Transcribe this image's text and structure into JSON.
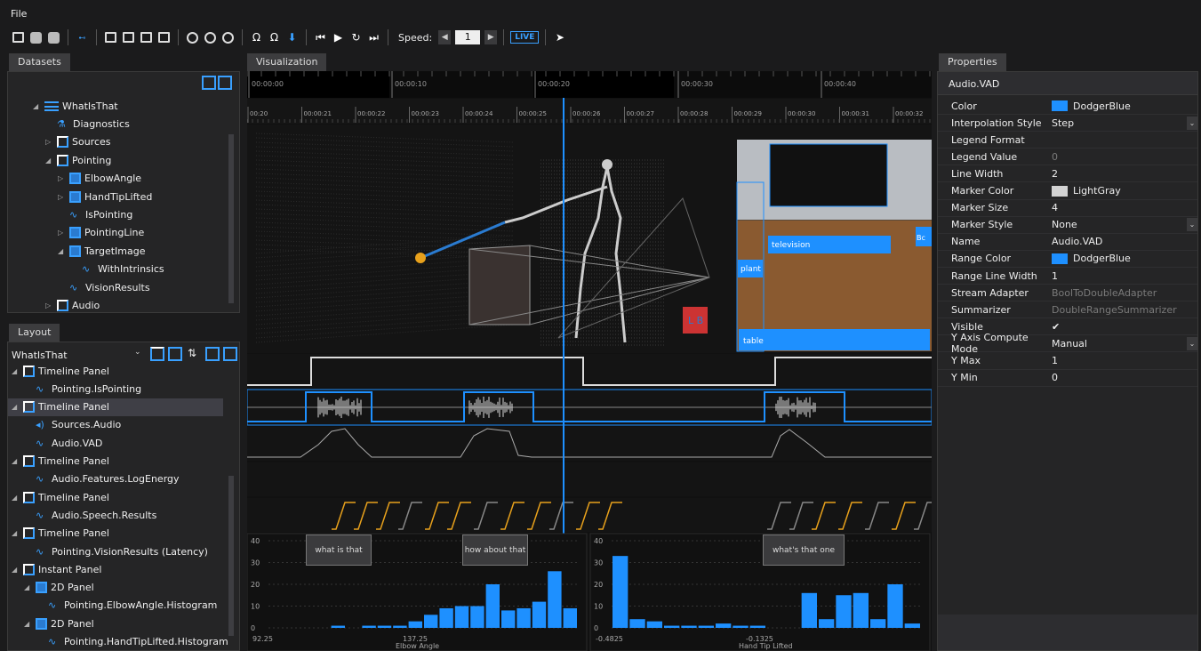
{
  "menu": {
    "file": "File"
  },
  "toolbar": {
    "speed_label": "Speed:",
    "speed_value": "1",
    "live": "LIVE"
  },
  "tabs": {
    "datasets": "Datasets",
    "visualization": "Visualization",
    "properties": "Properties",
    "layout": "Layout"
  },
  "datasets": {
    "items": [
      {
        "label": "WhatIsThat",
        "indent": 0,
        "arrow": "◢",
        "icon": "dataset"
      },
      {
        "label": "Diagnostics",
        "indent": 1,
        "arrow": "",
        "icon": "diag"
      },
      {
        "label": "Sources",
        "indent": 1,
        "arrow": "▷",
        "icon": "box"
      },
      {
        "label": "Pointing",
        "indent": 1,
        "arrow": "◢",
        "icon": "box"
      },
      {
        "label": "ElbowAngle",
        "indent": 2,
        "arrow": "▷",
        "icon": "bluebox"
      },
      {
        "label": "HandTipLifted",
        "indent": 2,
        "arrow": "▷",
        "icon": "bluebox"
      },
      {
        "label": "IsPointing",
        "indent": 2,
        "arrow": "",
        "icon": "wave"
      },
      {
        "label": "PointingLine",
        "indent": 2,
        "arrow": "▷",
        "icon": "bluebox"
      },
      {
        "label": "TargetImage",
        "indent": 2,
        "arrow": "◢",
        "icon": "bluebox"
      },
      {
        "label": "WithIntrinsics",
        "indent": 3,
        "arrow": "",
        "icon": "wave"
      },
      {
        "label": "VisionResults",
        "indent": 2,
        "arrow": "",
        "icon": "wave"
      },
      {
        "label": "Audio",
        "indent": 1,
        "arrow": "▷",
        "icon": "box"
      }
    ]
  },
  "layout": {
    "selected": "WhatIsThat",
    "items": [
      {
        "label": "Timeline Panel",
        "indent": 0,
        "arrow": "◢",
        "icon": "box"
      },
      {
        "label": "Pointing.IsPointing",
        "indent": 1,
        "arrow": "",
        "icon": "wave"
      },
      {
        "label": "Timeline Panel",
        "indent": 0,
        "arrow": "◢",
        "icon": "box",
        "selected": true
      },
      {
        "label": "Sources.Audio",
        "indent": 1,
        "arrow": "",
        "icon": "audio"
      },
      {
        "label": "Audio.VAD",
        "indent": 1,
        "arrow": "",
        "icon": "wave"
      },
      {
        "label": "Timeline Panel",
        "indent": 0,
        "arrow": "◢",
        "icon": "box"
      },
      {
        "label": "Audio.Features.LogEnergy",
        "indent": 1,
        "arrow": "",
        "icon": "wave"
      },
      {
        "label": "Timeline Panel",
        "indent": 0,
        "arrow": "◢",
        "icon": "box"
      },
      {
        "label": "Audio.Speech.Results",
        "indent": 1,
        "arrow": "",
        "icon": "wave"
      },
      {
        "label": "Timeline Panel",
        "indent": 0,
        "arrow": "◢",
        "icon": "box"
      },
      {
        "label": "Pointing.VisionResults (Latency)",
        "indent": 1,
        "arrow": "",
        "icon": "wave"
      },
      {
        "label": "Instant Panel",
        "indent": 0,
        "arrow": "◢",
        "icon": "box"
      },
      {
        "label": "2D Panel",
        "indent": 1,
        "arrow": "◢",
        "icon": "bluebox"
      },
      {
        "label": "Pointing.ElbowAngle.Histogram",
        "indent": 2,
        "arrow": "",
        "icon": "wave"
      },
      {
        "label": "2D Panel",
        "indent": 1,
        "arrow": "◢",
        "icon": "bluebox"
      },
      {
        "label": "Pointing.HandTipLifted.Histogram",
        "indent": 2,
        "arrow": "",
        "icon": "wave"
      }
    ]
  },
  "timeline": {
    "overview_ticks": [
      "00:00:00",
      "00:00:10",
      "00:00:20",
      "00:00:30",
      "00:00:40"
    ],
    "detail_ticks": [
      "00:20",
      "00:00:21",
      "00:00:22",
      "00:00:23",
      "00:00:24",
      "00:00:25",
      "00:00:26",
      "00:00:27",
      "00:00:28",
      "00:00:29",
      "00:00:30",
      "00:00:31",
      "00:00:32"
    ]
  },
  "scene": {
    "labels": {
      "television": "television",
      "plant": "plant",
      "table": "table",
      "bc": "Bc"
    }
  },
  "speech": [
    "what is that",
    "how about that",
    "what's that one"
  ],
  "chart_data": [
    {
      "type": "bar",
      "xlabel": "Elbow Angle",
      "x_ticks": [
        "92.25",
        "137.25"
      ],
      "y_ticks": [
        "0",
        "10",
        "20",
        "30",
        "40"
      ],
      "ylim": [
        0,
        40
      ],
      "grid": true,
      "values": [
        0,
        0,
        0,
        0,
        1,
        0,
        1,
        1,
        1,
        3,
        6,
        9,
        10,
        10,
        20,
        8,
        9,
        12,
        26,
        9
      ]
    },
    {
      "type": "bar",
      "xlabel": "Hand Tip Lifted",
      "x_ticks": [
        "-0.4825",
        "-0.1325"
      ],
      "y_ticks": [
        "0",
        "10",
        "20",
        "30",
        "40"
      ],
      "ylim": [
        0,
        40
      ],
      "grid": true,
      "values": [
        33,
        4,
        3,
        1,
        1,
        1,
        2,
        1,
        1,
        0,
        0,
        16,
        4,
        15,
        16,
        4,
        20,
        2
      ]
    }
  ],
  "properties": {
    "title": "Audio.VAD",
    "rows": [
      {
        "name": "Color",
        "value": "DodgerBlue",
        "swatch": "#1e90ff"
      },
      {
        "name": "Interpolation Style",
        "value": "Step",
        "dropdown": true
      },
      {
        "name": "Legend Format",
        "value": ""
      },
      {
        "name": "Legend Value",
        "value": "0",
        "dim": true
      },
      {
        "name": "Line Width",
        "value": "2"
      },
      {
        "name": "Marker Color",
        "value": "LightGray",
        "swatch": "#d3d3d3"
      },
      {
        "name": "Marker Size",
        "value": "4"
      },
      {
        "name": "Marker Style",
        "value": "None",
        "dropdown": true
      },
      {
        "name": "Name",
        "value": "Audio.VAD"
      },
      {
        "name": "Range Color",
        "value": "DodgerBlue",
        "swatch": "#1e90ff"
      },
      {
        "name": "Range Line Width",
        "value": "1"
      },
      {
        "name": "Stream Adapter",
        "value": "BoolToDoubleAdapter",
        "dim": true
      },
      {
        "name": "Summarizer",
        "value": "DoubleRangeSummarizer",
        "dim": true
      },
      {
        "name": "Visible",
        "value": "✔"
      },
      {
        "name": "Y Axis Compute Mode",
        "value": "Manual",
        "dropdown": true
      },
      {
        "name": "Y Max",
        "value": "1"
      },
      {
        "name": "Y Min",
        "value": "0"
      }
    ]
  },
  "colors": {
    "accent": "#1e90ff",
    "orange": "#e8a11c"
  }
}
